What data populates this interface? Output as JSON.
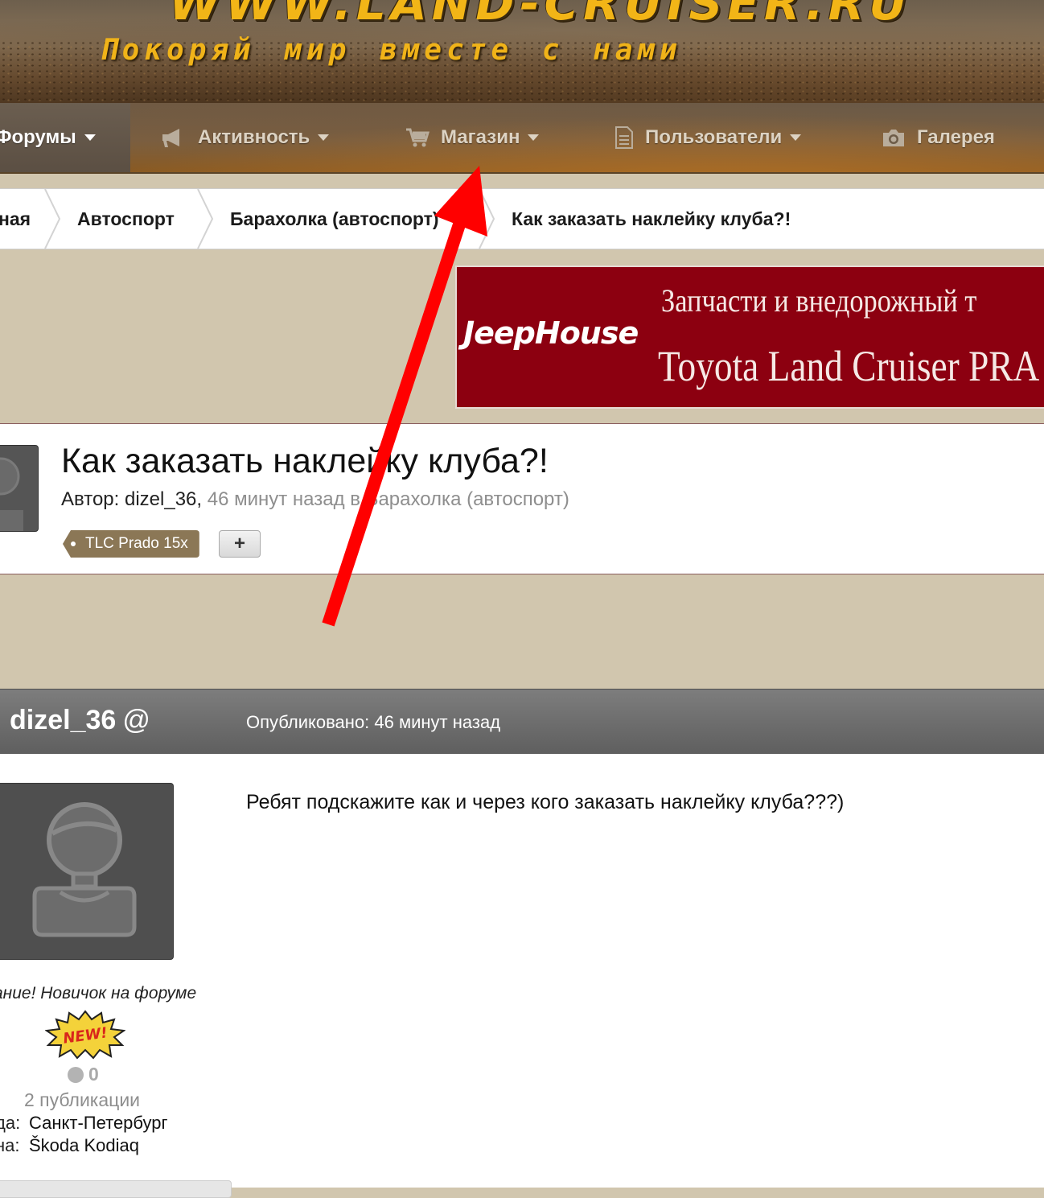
{
  "header": {
    "logo_text": "WWW.LAND-CRUISER.RU",
    "slogan": "Покоряй мир вместе с нами"
  },
  "nav": {
    "items": [
      {
        "label": "Форумы",
        "icon": "chevron-down-icon",
        "active": true
      },
      {
        "label": "Активность",
        "icon": "megaphone-icon"
      },
      {
        "label": "Магазин",
        "icon": "cart-icon"
      },
      {
        "label": "Пользователи",
        "icon": "document-icon"
      },
      {
        "label": "Галерея",
        "icon": "camera-icon"
      }
    ]
  },
  "breadcrumb": {
    "items": [
      "ная",
      "Автоспорт",
      "Барахолка (автоспорт)",
      "Как заказать наклейку клуба?!"
    ]
  },
  "ad": {
    "brand": "JeepHouse",
    "line1": "Запчасти и внедорожный т",
    "line2": "Toyota Land Cruiser PRA"
  },
  "topic": {
    "title": "Как заказать наклейку клуба?!",
    "author_prefix": "Автор: dizel_36,",
    "time_and_forum": " 46 минут назад в Барахолка (автоспорт)",
    "tag": "TLC Prado 15x",
    "add_tag_label": "+"
  },
  "post": {
    "author": "dizel_36",
    "mention_symbol": "@",
    "published": "Опубликовано: 46 минут назад",
    "text": "Ребят подскажите как и через кого заказать наклейку клуба???)",
    "user_title": "ание! Новичок на форуме",
    "badge_text": "NEW!",
    "reputation": "0",
    "posts_count": "2 публикации",
    "city_label": "да:",
    "city": "Санкт-Петербург",
    "car_label": "на:",
    "car": "Škoda Kodiaq"
  },
  "colors": {
    "accent_gold": "#f2b517",
    "ad_red": "#8c0010",
    "tag_brown": "#8b7756",
    "annotation_arrow": "#ff0000"
  }
}
